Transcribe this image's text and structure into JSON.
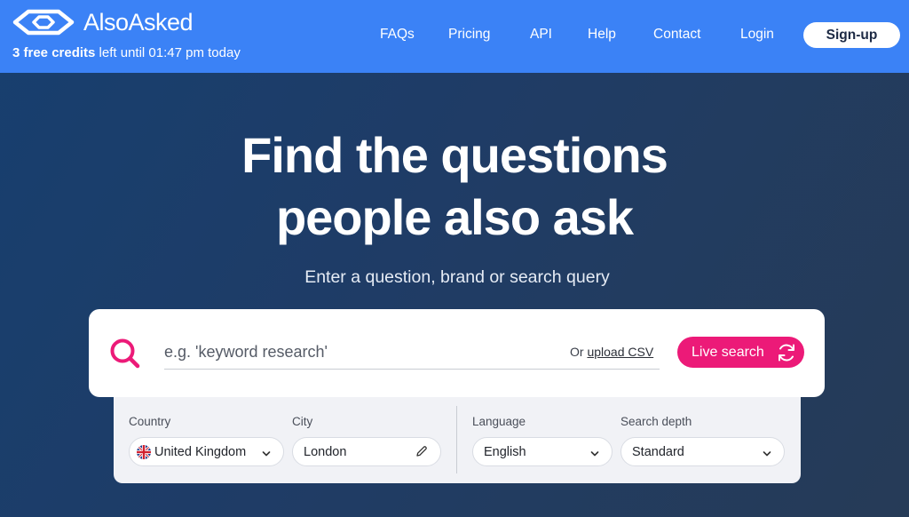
{
  "brand": {
    "name": "AlsoAsked"
  },
  "credits": {
    "bold": "3 free credits",
    "rest": " left until 01:47 pm today"
  },
  "nav": {
    "faqs": "FAQs",
    "pricing": "Pricing",
    "api": "API",
    "help": "Help",
    "contact": "Contact",
    "login": "Login",
    "signup": "Sign-up"
  },
  "hero": {
    "title_line1": "Find the questions",
    "title_line2": "people also ask",
    "subtitle": "Enter a question, brand or search query"
  },
  "search": {
    "placeholder": "e.g. 'keyword research'",
    "upload_prefix": "Or ",
    "upload_link": "upload CSV",
    "live_button": "Live search"
  },
  "options": {
    "country_label": "Country",
    "country_value": "United Kingdom",
    "city_label": "City",
    "city_value": "London",
    "language_label": "Language",
    "language_value": "English",
    "depth_label": "Search depth",
    "depth_value": "Standard"
  },
  "colors": {
    "topbar": "#3b82f6",
    "accent_pink": "#ec1a78",
    "hero_bg": "#1f3c66"
  },
  "icons": {
    "logo": "eye-hexagon-logo-icon",
    "search": "search-icon",
    "refresh": "refresh-icon",
    "edit": "pencil-icon",
    "chevron": "chevron-down-icon",
    "flag": "uk-flag-icon"
  }
}
